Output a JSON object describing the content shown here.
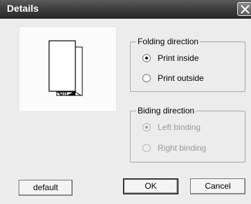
{
  "window": {
    "title": "Details",
    "close_icon": "close-icon"
  },
  "preview": {
    "icon": "folded-page-icon"
  },
  "folding": {
    "legend": "Folding direction",
    "options": [
      {
        "label": "Print inside",
        "selected": true,
        "enabled": true
      },
      {
        "label": "Print outside",
        "selected": false,
        "enabled": true
      }
    ]
  },
  "binding": {
    "legend": "Biding direction",
    "options": [
      {
        "label": "Left binding",
        "selected": true,
        "enabled": false
      },
      {
        "label": "Right binding",
        "selected": false,
        "enabled": false
      }
    ]
  },
  "buttons": {
    "default_label": "default",
    "ok_label": "OK",
    "cancel_label": "Cancel"
  }
}
